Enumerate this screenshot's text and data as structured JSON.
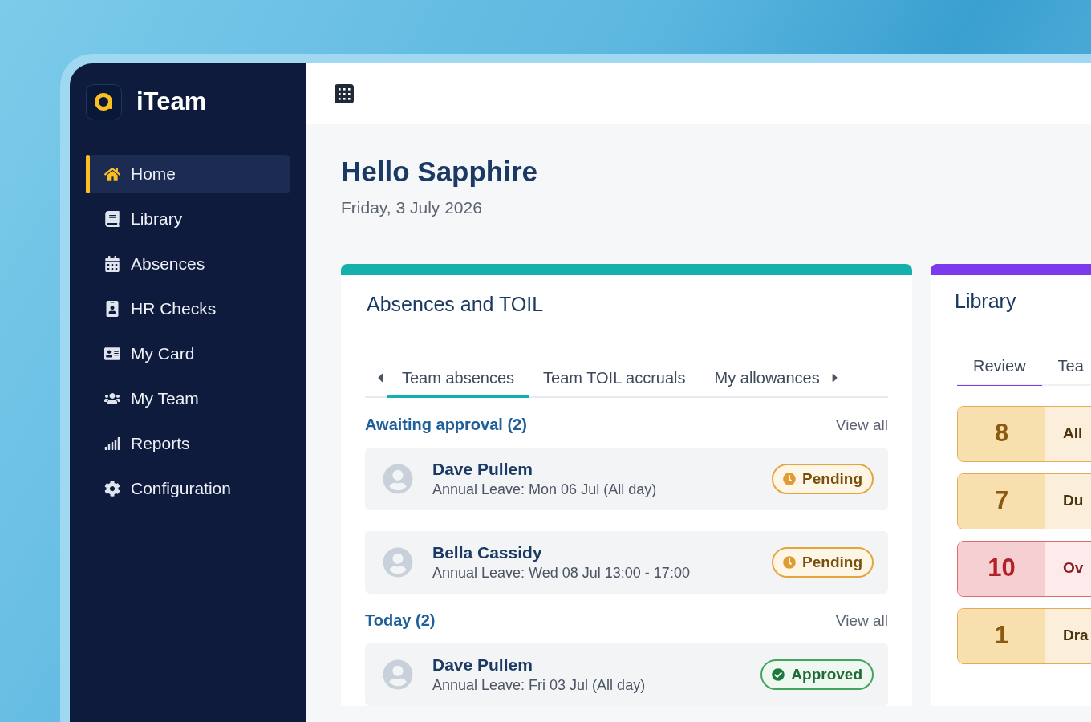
{
  "app": {
    "name": "iTeam"
  },
  "nav": [
    {
      "label": "Home",
      "selected": true
    },
    {
      "label": "Library",
      "selected": false
    },
    {
      "label": "Absences",
      "selected": false
    },
    {
      "label": "HR Checks",
      "selected": false
    },
    {
      "label": "My Card",
      "selected": false
    },
    {
      "label": "My Team",
      "selected": false
    },
    {
      "label": "Reports",
      "selected": false
    },
    {
      "label": "Configuration",
      "selected": false
    }
  ],
  "greeting": {
    "title": "Hello Sapphire",
    "date": "Friday, 3 July 2026"
  },
  "absences_card": {
    "title": "Absences and TOIL",
    "tabs": [
      {
        "label": "Team absences",
        "selected": true
      },
      {
        "label": "Team TOIL accruals",
        "selected": false
      },
      {
        "label": "My allowances",
        "selected": false
      }
    ],
    "sections": [
      {
        "title": "Awaiting approval (2)",
        "link": "View all",
        "items": [
          {
            "name": "Dave Pullem",
            "detail": "Annual Leave: Mon 06 Jul (All day)",
            "status": {
              "kind": "pending",
              "label": "Pending"
            }
          },
          {
            "name": "Bella Cassidy",
            "detail": "Annual Leave: Wed 08 Jul 13:00 - 17:00",
            "status": {
              "kind": "pending",
              "label": "Pending"
            }
          }
        ]
      },
      {
        "title": "Today (2)",
        "link": "View all",
        "items": [
          {
            "name": "Dave Pullem",
            "detail": "Annual Leave: Fri 03 Jul (All day)",
            "status": {
              "kind": "approved",
              "label": "Approved"
            }
          }
        ]
      }
    ]
  },
  "library_card": {
    "title": "Library",
    "tabs": [
      {
        "label": "Review",
        "selected": true
      },
      {
        "label": "Tea",
        "selected": false
      }
    ],
    "tiles": [
      {
        "count": "8",
        "label": "All",
        "kind": "warning"
      },
      {
        "count": "7",
        "label": "Du",
        "kind": "warning"
      },
      {
        "count": "10",
        "label": "Ov",
        "kind": "danger"
      },
      {
        "count": "1",
        "label": "Dra",
        "kind": "warning"
      }
    ]
  }
}
